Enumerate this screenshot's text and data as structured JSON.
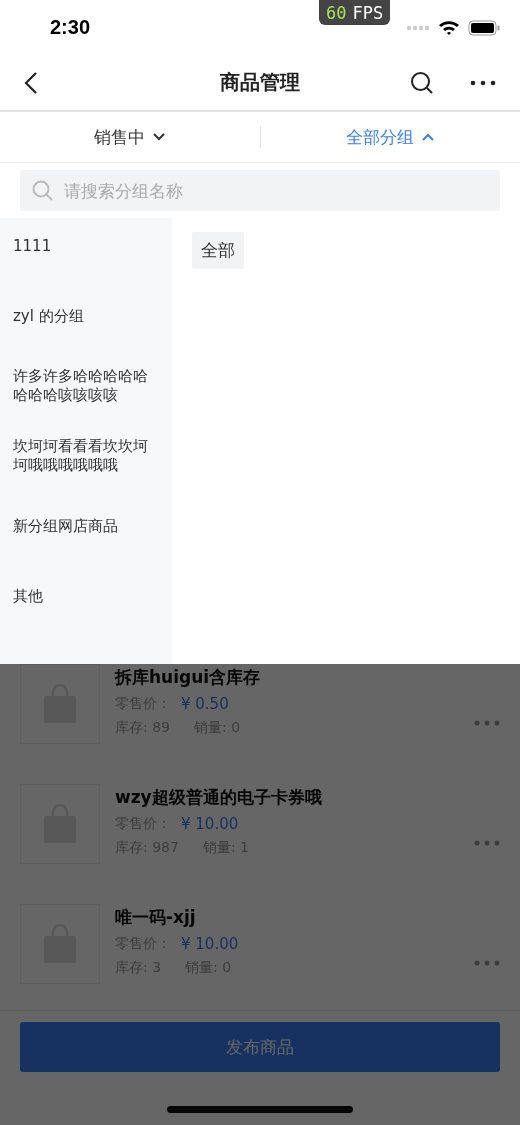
{
  "status_bar": {
    "time": "2:30",
    "fps_badge": {
      "value": "60",
      "unit": "FPS"
    }
  },
  "nav": {
    "title": "商品管理"
  },
  "filters": [
    {
      "label": "销售中",
      "expanded": false,
      "selected": false
    },
    {
      "label": "全部分组",
      "expanded": true,
      "selected": true
    }
  ],
  "search": {
    "placeholder": "请搜索分组名称"
  },
  "group_panel": {
    "categories": [
      {
        "label": "1111"
      },
      {
        "label": "zyl 的分组"
      },
      {
        "label": "许多许多哈哈哈哈哈哈哈哈咳咳咳咳"
      },
      {
        "label": "坎坷坷看看看坎坎坷坷哦哦哦哦哦哦"
      },
      {
        "label": "新分组网店商品"
      },
      {
        "label": "其他"
      }
    ],
    "tags": [
      {
        "label": "全部",
        "selected": true
      }
    ]
  },
  "products": [
    {
      "name": "拆库huigui含库存",
      "price_label": "零售价：",
      "price": "¥ 0.50",
      "stock": "库存: 89",
      "sales": "销量: 0"
    },
    {
      "name": "wzy超级普通的电子卡券哦",
      "price_label": "零售价：",
      "price": "¥ 10.00",
      "stock": "库存: 987",
      "sales": "销量: 1"
    },
    {
      "name": "唯一码-xjj",
      "price_label": "零售价：",
      "price": "¥ 10.00",
      "stock": "库存: 3",
      "sales": "销量: 0"
    }
  ],
  "publish_button": "发布商品"
}
